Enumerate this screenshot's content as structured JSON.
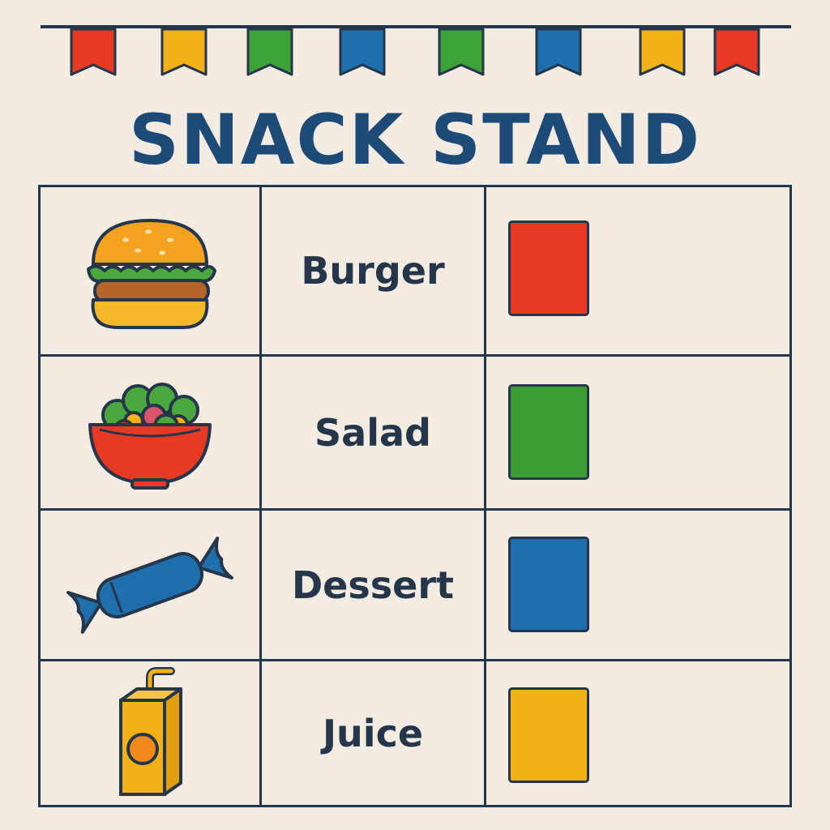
{
  "header": {
    "title": "SNACK STAND",
    "bunting_flags": [
      "#e63a24",
      "#f4b21a",
      "#3ea23a",
      "#1f6fad",
      "#3ea23a",
      "#1f6fad",
      "#f4b21a",
      "#e63a24"
    ]
  },
  "menu": {
    "items": [
      {
        "icon": "burger-icon",
        "label": "Burger",
        "color": "#e63a24"
      },
      {
        "icon": "salad-bowl-icon",
        "label": "Salad",
        "color": "#3a9c35"
      },
      {
        "icon": "wrapped-candy-icon",
        "label": "Dessert",
        "color": "#1f6fad"
      },
      {
        "icon": "juice-box-icon",
        "label": "Juice",
        "color": "#f4b21a"
      }
    ]
  },
  "colors": {
    "ink": "#25364a",
    "title": "#1d4a77",
    "background": "#f3ece3"
  }
}
